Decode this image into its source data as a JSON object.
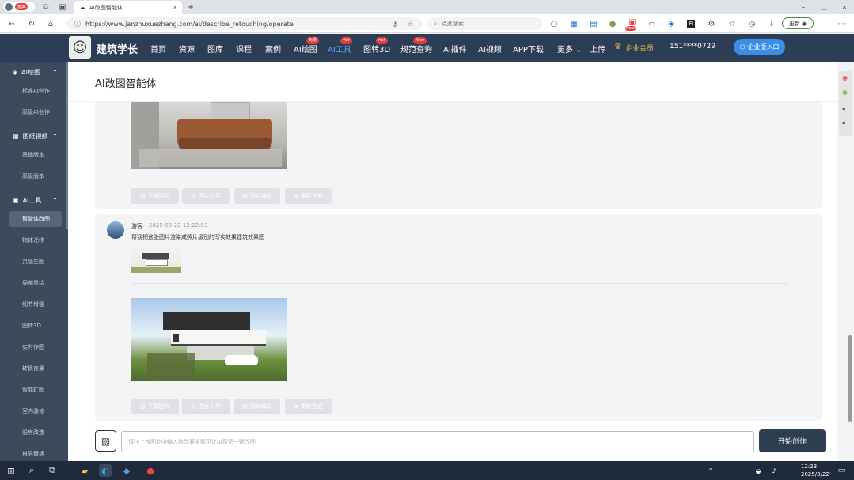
{
  "browser": {
    "profile": "游客",
    "tab_title": "AI改图智能体",
    "url": "https://www.janzhuxuezhang.com/ai/describe_retouching/operate",
    "search_placeholder": "点此搜索",
    "ext_badge": "New",
    "update_label": "更新"
  },
  "site": {
    "logo_text": "建筑学长",
    "nav": [
      {
        "label": "首页"
      },
      {
        "label": "资源"
      },
      {
        "label": "图库"
      },
      {
        "label": "课程"
      },
      {
        "label": "案例"
      },
      {
        "label": "AI绘图",
        "badge": "免费"
      },
      {
        "label": "AI工具",
        "badge": "Hot"
      },
      {
        "label": "图转3D",
        "badge": "Hot"
      },
      {
        "label": "规范查询",
        "badge": "New"
      },
      {
        "label": "AI插件"
      },
      {
        "label": "AI视频"
      },
      {
        "label": "APP下载"
      },
      {
        "label": "更多"
      },
      {
        "label": "上传"
      }
    ],
    "vip_label": "企业会员",
    "phone": "151****0729",
    "enterprise_btn": "企业版入口"
  },
  "sidebar": {
    "groups": [
      {
        "label": "AI绘图",
        "items": [
          "标准AI创作",
          "高级AI创作"
        ]
      },
      {
        "label": "图纸视频",
        "items": [
          "基础版本",
          "高级版本"
        ]
      },
      {
        "label": "AI工具",
        "items": [
          "智能体改图",
          "物体迁移",
          "灵感生图",
          "局部重绘",
          "细节增强",
          "图转3D",
          "实时作图",
          "转换夜景",
          "智能扩图",
          "室内装修",
          "旧房改造",
          "材质替换"
        ]
      }
    ],
    "active_item": "智能体改图"
  },
  "page": {
    "title": "AI改图智能体"
  },
  "actions": {
    "download": "下载图片",
    "reference": "图片引用",
    "edit": "图片编辑",
    "regenerate": "重新生成"
  },
  "message": {
    "user": "游客",
    "time": "2025-03-22 12:22:03",
    "text": "帮我把这张图片渲染成照片级别的写实效果建筑效果图"
  },
  "input": {
    "placeholder": "请在上传图片中输入修改要求即可让AI帮您一键改图",
    "submit": "开始创作"
  },
  "taskbar": {
    "time": "12:23",
    "date": "2025/3/22"
  },
  "colors": {
    "nav_bg": "#2c3e56",
    "sidebar_bg": "#3c4a5d",
    "primary_btn": "#2c3e50",
    "badge_red": "#e23c3c"
  }
}
